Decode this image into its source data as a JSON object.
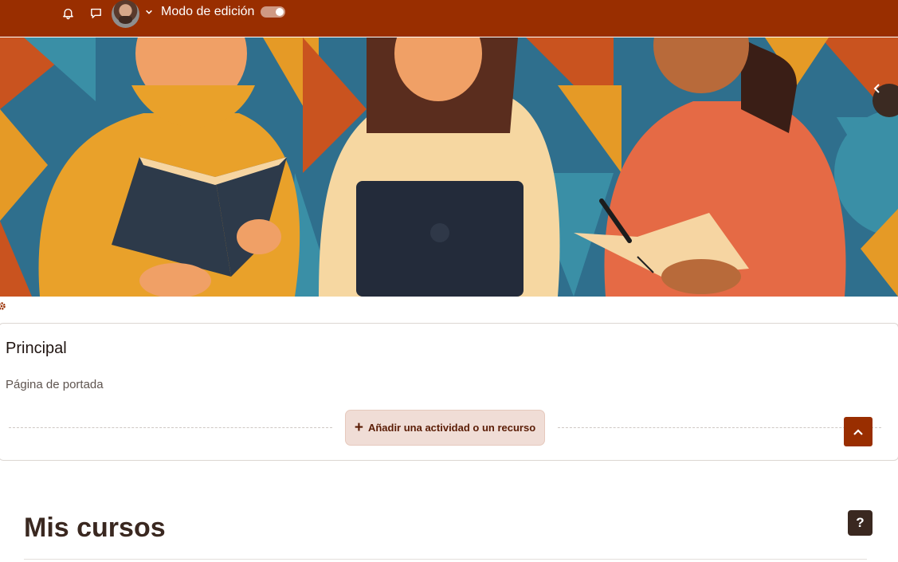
{
  "topbar": {
    "bg_color": "#992e00",
    "icons": [
      "bell-icon",
      "chat-bubble-icon",
      "user-avatar",
      "chevron-down-icon"
    ],
    "edit_mode_label": "Modo de edición",
    "edit_mode_on": true
  },
  "banner": {
    "description_icon": "course-banner-illustration",
    "drawer_toggle_icon": "chevron-left-icon"
  },
  "section": {
    "title": "Principal",
    "subtitle": "Página de portada",
    "add_activity_label": "Añadir una actividad o un recurso",
    "collapse_icon": "chevron-up-icon"
  },
  "my_courses": {
    "title": "Mis cursos",
    "help_label": "?"
  },
  "colors": {
    "brand": "#992e00",
    "dark": "#3a2820",
    "add_button_bg": "#f0ddd6"
  }
}
